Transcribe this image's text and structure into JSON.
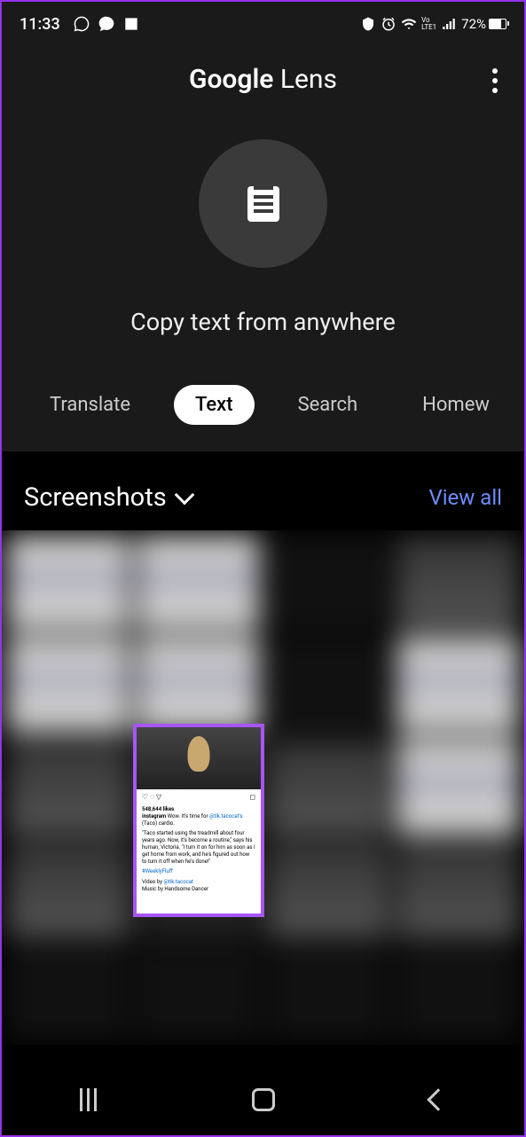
{
  "status": {
    "time": "11:33",
    "battery_pct": "72%"
  },
  "header": {
    "title_bold": "Google",
    "title_light": "Lens"
  },
  "hero": {
    "text": "Copy text from anywhere"
  },
  "tabs": [
    {
      "label": "Translate",
      "active": false
    },
    {
      "label": "Text",
      "active": true
    },
    {
      "label": "Search",
      "active": false
    },
    {
      "label": "Homew",
      "active": false
    }
  ],
  "section": {
    "title": "Screenshots",
    "view_all": "View all"
  },
  "highlight": {
    "likes": "548,644 likes",
    "account": "instagram",
    "caption_start": "Wow. It's time for ",
    "caption_link": "@tik.tacocat's",
    "caption_end": " (Taco) cardio.",
    "body": "\"Taco started using the treadmill about four years ago. Now, it's become a routine,\" says his human, Victoria. \"I turn it on for him as soon as I get home from work, and he's figured out how to turn it off when he's done!\"",
    "hashtag": "#WeeklyFluff",
    "video_by": "Video by ",
    "video_link": "@tik.tacocat",
    "music": "Music by Handsome Dancer"
  }
}
